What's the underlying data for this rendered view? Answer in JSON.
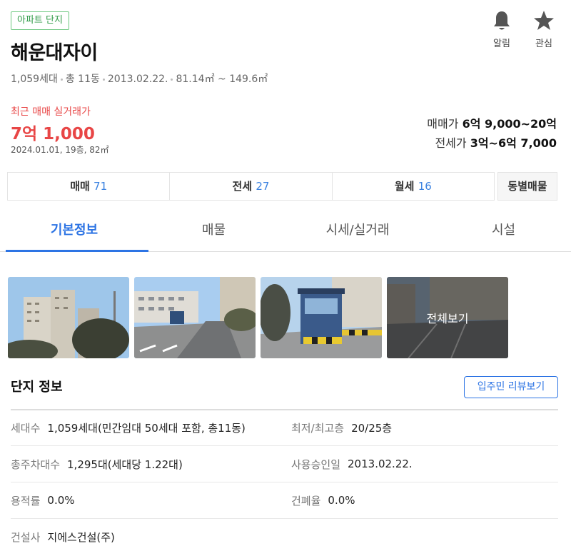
{
  "badge": "아파트 단지",
  "title": "해운대자이",
  "meta": [
    "1,059세대",
    "총 11동",
    "2013.02.22.",
    "81.14㎡ ~ 149.6㎡"
  ],
  "actions": {
    "alarm": "알림",
    "favorite": "관심"
  },
  "recent": {
    "label": "최근 매매 실거래가",
    "price": "7억 1,000",
    "detail": "2024.01.01, 19층, 82㎡"
  },
  "prices": {
    "sale_label": "매매가",
    "sale_value": "6억 9,000~20억",
    "jeonse_label": "전세가",
    "jeonse_value": "3억~6억 7,000"
  },
  "trade": [
    {
      "label": "매매",
      "count": "71"
    },
    {
      "label": "전세",
      "count": "27"
    },
    {
      "label": "월세",
      "count": "16"
    }
  ],
  "dong_button": "동별매물",
  "tabs": [
    "기본정보",
    "매물",
    "시세/실거래",
    "시설"
  ],
  "photos": {
    "more_label": "전체보기"
  },
  "section": {
    "title": "단지 정보",
    "review_button": "입주민 리뷰보기"
  },
  "info": [
    {
      "l_label": "세대수",
      "l_value": "1,059세대(민간임대 50세대 포함, 총11동)",
      "r_label": "최저/최고층",
      "r_value": "20/25층"
    },
    {
      "l_label": "총주차대수",
      "l_value": "1,295대(세대당 1.22대)",
      "r_label": "사용승인일",
      "r_value": "2013.02.22."
    },
    {
      "l_label": "용적률",
      "l_value": "0.0%",
      "r_label": "건폐율",
      "r_value": "0.0%"
    },
    {
      "l_label": "건설사",
      "l_value": "지에스건설(주)",
      "r_label": "",
      "r_value": ""
    }
  ],
  "colors": {
    "accent": "#2d74e4",
    "price_red": "#e84646",
    "badge_green": "#2f9a47"
  }
}
